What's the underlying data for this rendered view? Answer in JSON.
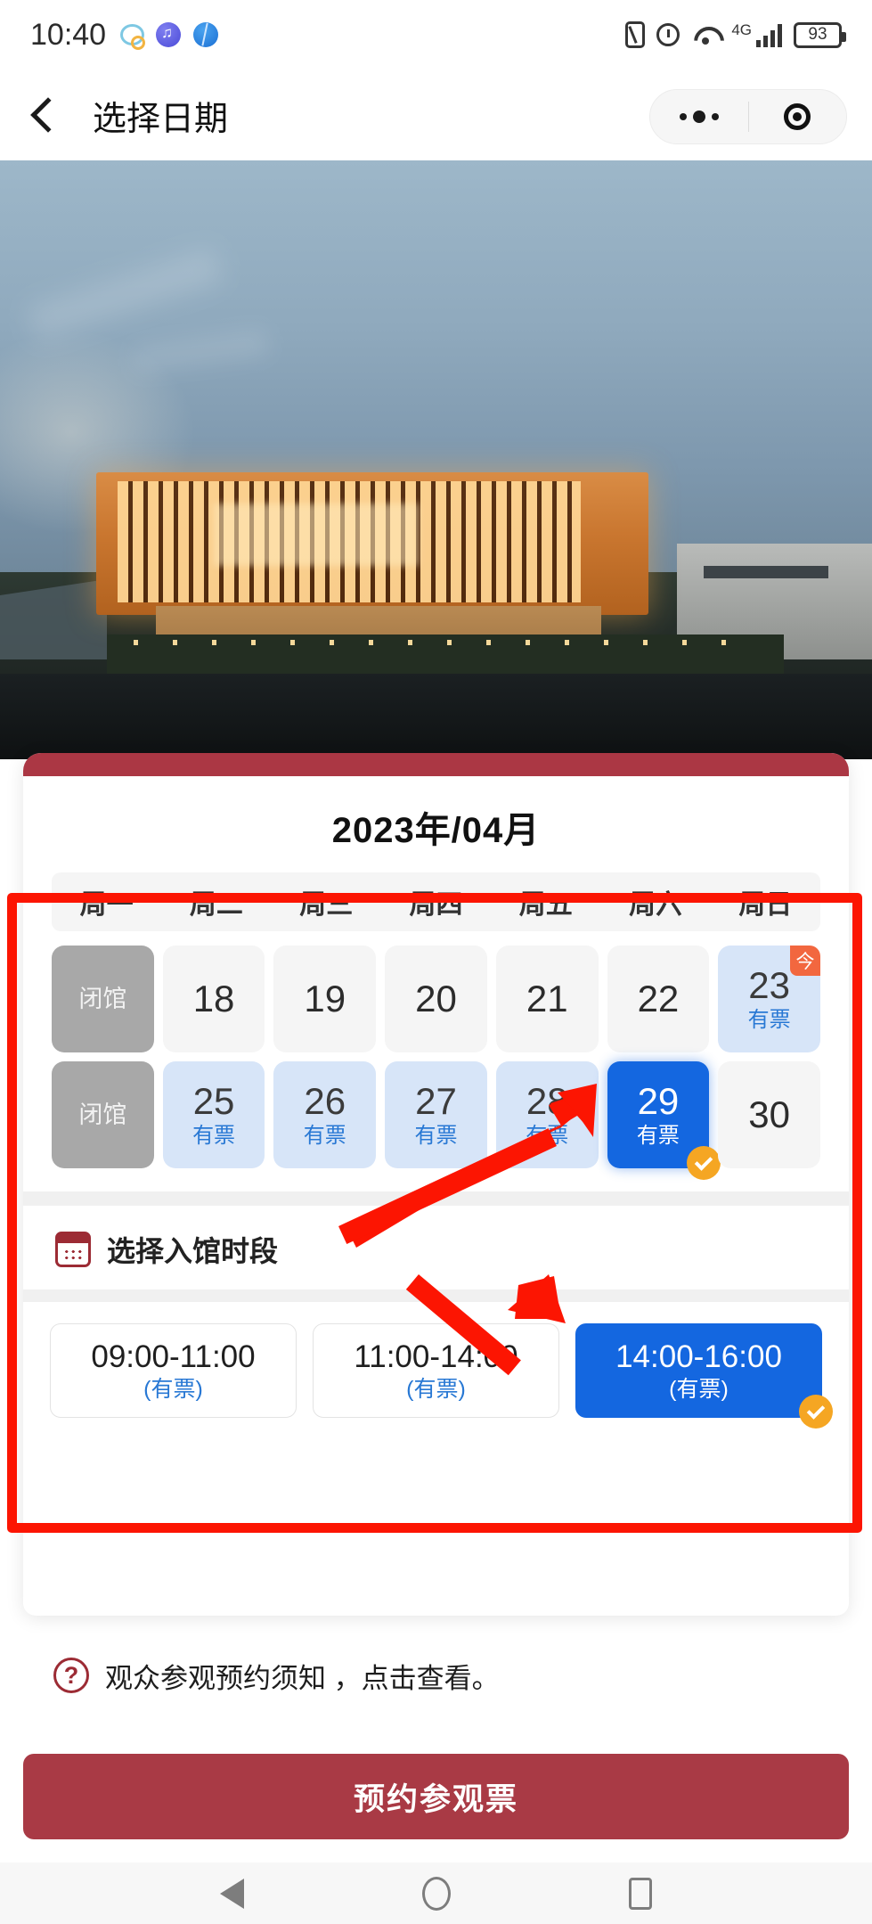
{
  "statusbar": {
    "time": "10:40",
    "battery": "93",
    "network": "4G",
    "icons": [
      "chat-icon",
      "music-icon",
      "browser-icon",
      "nfc-icon",
      "alarm-icon",
      "wifi-icon",
      "signal-bars-icon",
      "battery-icon"
    ]
  },
  "navbar": {
    "title": "选择日期",
    "back_icon": "chevron-left-icon",
    "capsule": {
      "more_icon": "more-dots-icon",
      "target_icon": "target-circle-icon"
    }
  },
  "hero": {
    "alt": "museum-building-at-dusk"
  },
  "calendar": {
    "month_title": "2023年/04月",
    "weekdays": [
      "周一",
      "周二",
      "周三",
      "周四",
      "周五",
      "周六",
      "周日"
    ],
    "days": [
      {
        "label": "闭馆",
        "ticket": "",
        "state": "closed",
        "badge": ""
      },
      {
        "label": "18",
        "ticket": "",
        "state": "past",
        "badge": ""
      },
      {
        "label": "19",
        "ticket": "",
        "state": "past",
        "badge": ""
      },
      {
        "label": "20",
        "ticket": "",
        "state": "past",
        "badge": ""
      },
      {
        "label": "21",
        "ticket": "",
        "state": "past",
        "badge": ""
      },
      {
        "label": "22",
        "ticket": "",
        "state": "past",
        "badge": ""
      },
      {
        "label": "23",
        "ticket": "有票",
        "state": "avail",
        "badge": "今"
      },
      {
        "label": "闭馆",
        "ticket": "",
        "state": "closed",
        "badge": ""
      },
      {
        "label": "25",
        "ticket": "有票",
        "state": "avail",
        "badge": ""
      },
      {
        "label": "26",
        "ticket": "有票",
        "state": "avail",
        "badge": ""
      },
      {
        "label": "27",
        "ticket": "有票",
        "state": "avail",
        "badge": ""
      },
      {
        "label": "28",
        "ticket": "有票",
        "state": "avail",
        "badge": ""
      },
      {
        "label": "29",
        "ticket": "有票",
        "state": "selected",
        "badge": ""
      },
      {
        "label": "30",
        "ticket": "",
        "state": "past",
        "badge": ""
      }
    ]
  },
  "timeslot_section": {
    "icon": "calendar-icon",
    "title": "选择入馆时段",
    "slots": [
      {
        "range": "09:00-11:00",
        "status": "(有票)",
        "selected": false
      },
      {
        "range": "11:00-14:00",
        "status": "(有票)",
        "selected": false
      },
      {
        "range": "14:00-16:00",
        "status": "(有票)",
        "selected": true
      }
    ]
  },
  "notice": {
    "icon": "question-circle-icon",
    "text": "观众参观预约须知 ，点击查看。"
  },
  "footer": {
    "cta_label": "预约参观票"
  },
  "androidnav": {
    "back_icon": "triangle-back-icon",
    "home_icon": "circle-home-icon",
    "recents_icon": "square-recents-icon"
  },
  "annotations": {
    "highlight_color": "#fc1502",
    "arrow_1_target": "day-29",
    "arrow_2_target": "timeslot-14:00-16:00"
  },
  "colors": {
    "brand_red": "#a93a45",
    "card_topbar": "#ab3744",
    "selected_blue": "#1467e0",
    "available_blue_bg": "#d7e5f8",
    "ticket_text_blue": "#2878d4",
    "today_badge": "#f2673f",
    "check_orange": "#f5a623",
    "closed_gray": "#a8a8a8",
    "annotation_red": "#fc1502"
  }
}
